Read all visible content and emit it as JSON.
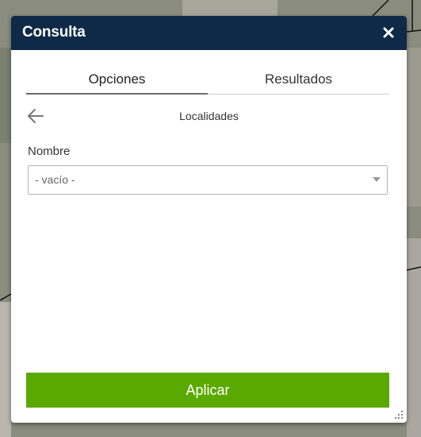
{
  "panel": {
    "title": "Consulta",
    "close_icon": "close-icon"
  },
  "tabs": [
    {
      "label": "Opciones",
      "active": true
    },
    {
      "label": "Resultados",
      "active": false
    }
  ],
  "section": {
    "back_icon": "arrow-left-icon",
    "title": "Localidades"
  },
  "form": {
    "nombre_label": "Nombre",
    "nombre_value": "- vacío -"
  },
  "actions": {
    "apply_label": "Aplicar"
  },
  "colors": {
    "header_bg": "#0f2a47",
    "apply_bg": "#5aa900",
    "tab_indicator": "#6b6b6b"
  }
}
